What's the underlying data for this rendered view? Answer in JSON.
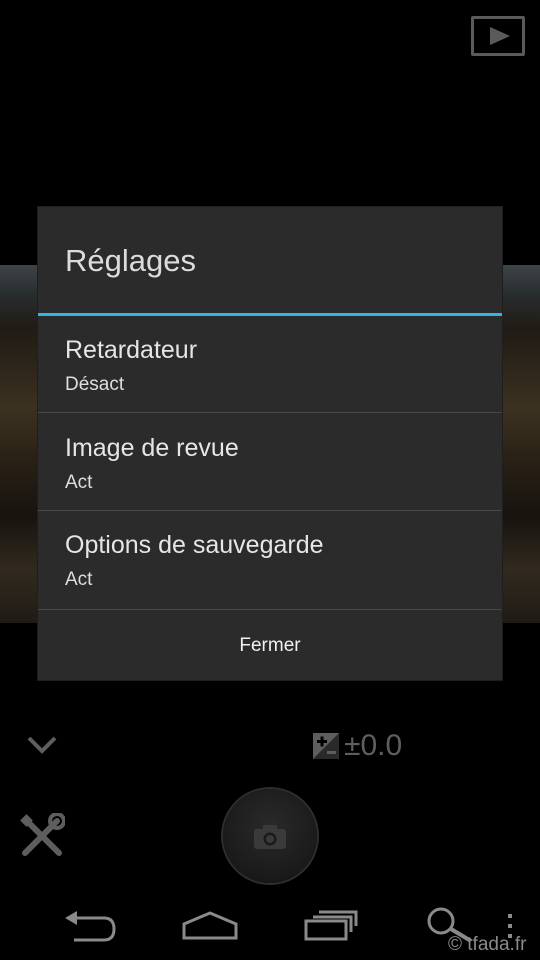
{
  "dialog": {
    "title": "Réglages",
    "items": [
      {
        "label": "Retardateur",
        "value": "Désact"
      },
      {
        "label": "Image de revue",
        "value": "Act"
      },
      {
        "label": "Options de sauvegarde",
        "value": "Act"
      }
    ],
    "close_label": "Fermer"
  },
  "camera": {
    "exposure": "±0.0"
  },
  "watermark": "© tfada.fr",
  "colors": {
    "accent": "#33b5e5",
    "dialog_bg": "#2b2b2b"
  }
}
